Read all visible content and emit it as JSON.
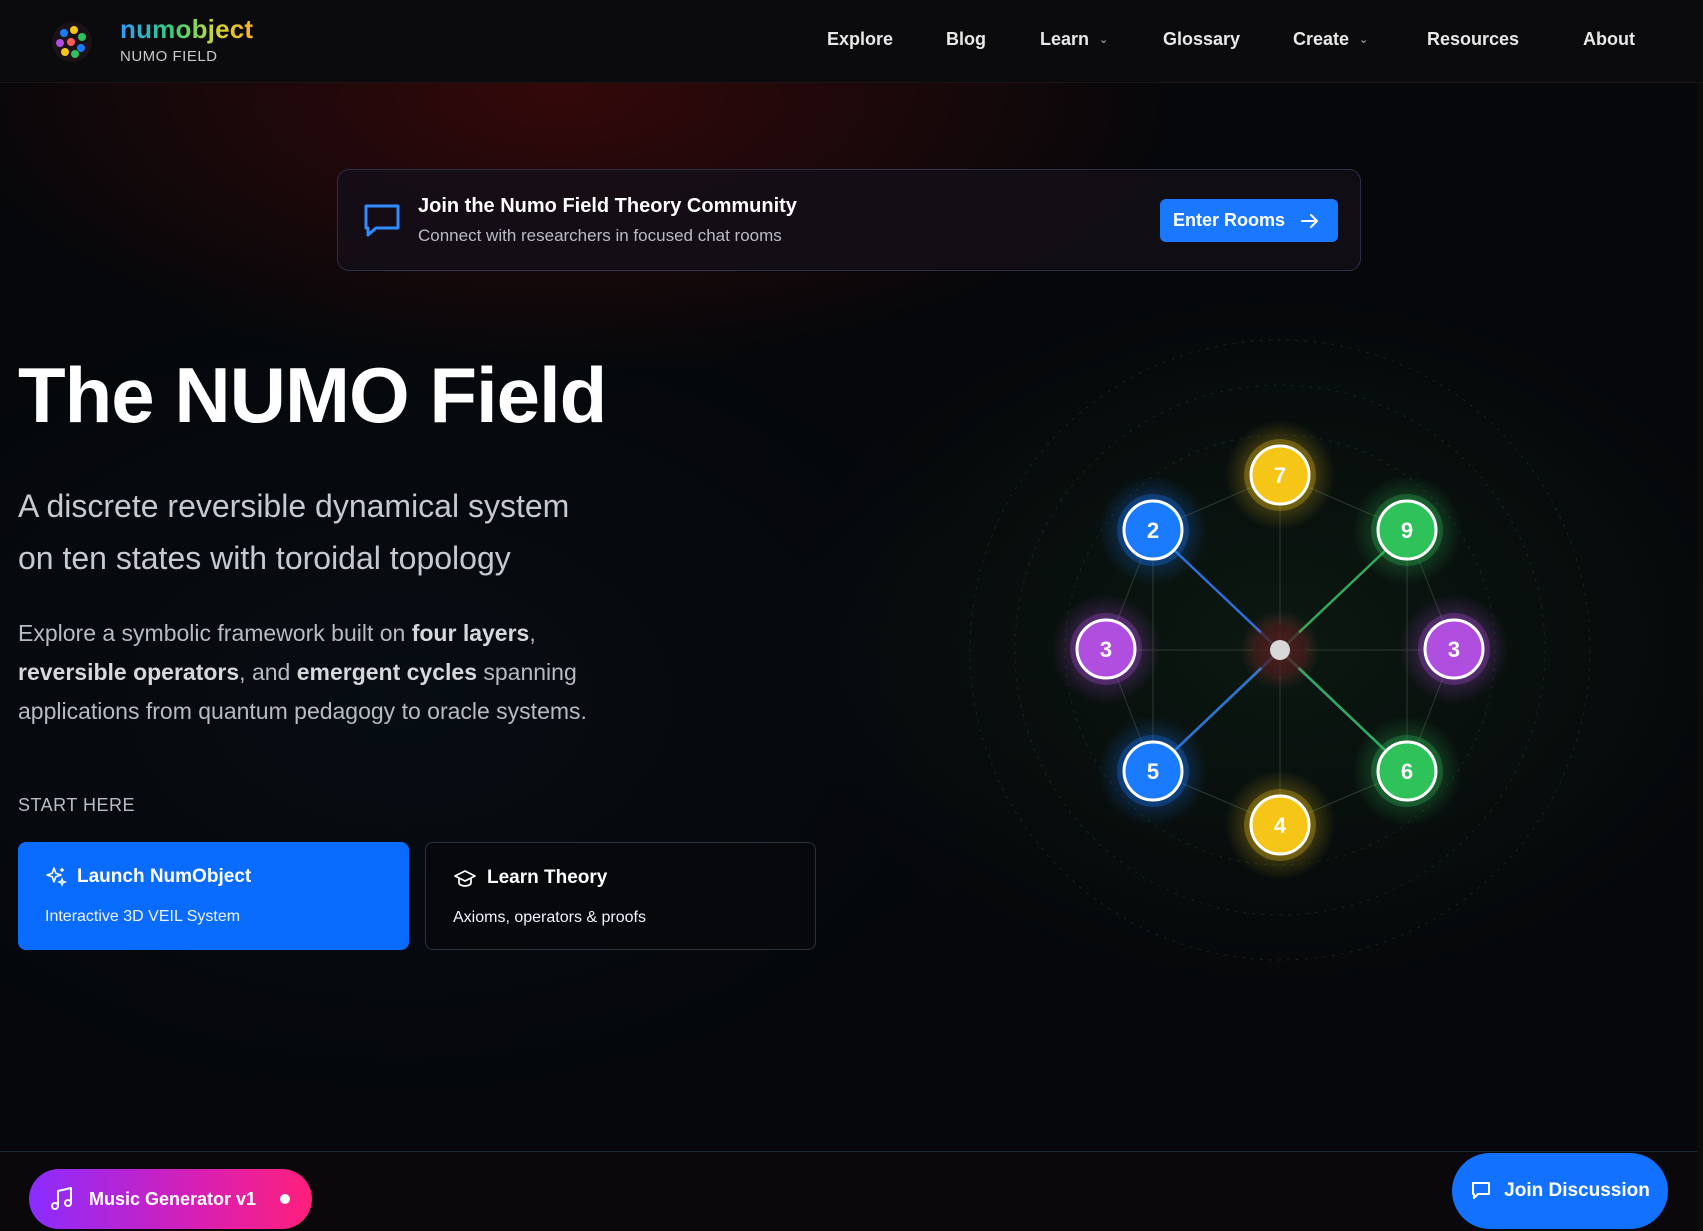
{
  "header": {
    "brand_name": "numobject",
    "brand_sub": "NUMO FIELD",
    "nav": [
      {
        "label": "Explore",
        "dropdown": false
      },
      {
        "label": "Blog",
        "dropdown": false
      },
      {
        "label": "Learn",
        "dropdown": true
      },
      {
        "label": "Glossary",
        "dropdown": false
      },
      {
        "label": "Create",
        "dropdown": true
      },
      {
        "label": "Resources",
        "dropdown": false
      },
      {
        "label": "About",
        "dropdown": false
      }
    ]
  },
  "banner": {
    "title": "Join the Numo Field Theory Community",
    "subtitle": "Connect with researchers in focused chat rooms",
    "button_label": "Enter Rooms",
    "icon": "chat-bubble-icon"
  },
  "hero": {
    "title": "The NUMO Field",
    "subtitle_line1": "A discrete reversible dynamical system",
    "subtitle_line2": "on ten states with toroidal topology",
    "desc_1": "Explore a symbolic framework built on ",
    "desc_b1": "four layers",
    "desc_2": ",",
    "desc_b2": "reversible operators",
    "desc_3": ", and ",
    "desc_b3": "emergent cycles",
    "desc_4": " spanning applications from quantum pedagogy to oracle systems.",
    "start_label": "START HERE"
  },
  "cards": {
    "primary": {
      "title": "Launch NumObject",
      "subtitle": "Interactive 3D VEIL System",
      "icon": "sparkles-icon"
    },
    "secondary": {
      "title": "Learn Theory",
      "subtitle": "Axioms, operators & proofs",
      "icon": "graduation-cap-icon"
    }
  },
  "diagram": {
    "nodes": [
      {
        "label": "7",
        "color": "#f5c518"
      },
      {
        "label": "2",
        "color": "#1a7bff"
      },
      {
        "label": "9",
        "color": "#2fc15a"
      },
      {
        "label": "3",
        "color": "#b04ee0"
      },
      {
        "label": "3",
        "color": "#b04ee0"
      },
      {
        "label": "5",
        "color": "#1a7bff"
      },
      {
        "label": "6",
        "color": "#2fc15a"
      },
      {
        "label": "4",
        "color": "#f5c518"
      }
    ]
  },
  "footer": {
    "music_label": "Music Generator v1",
    "join_label": "Join Discussion"
  },
  "colors": {
    "accent_blue": "#1a78ff",
    "music_gradient_start": "#8a2cff",
    "music_gradient_end": "#ff1f7a"
  }
}
